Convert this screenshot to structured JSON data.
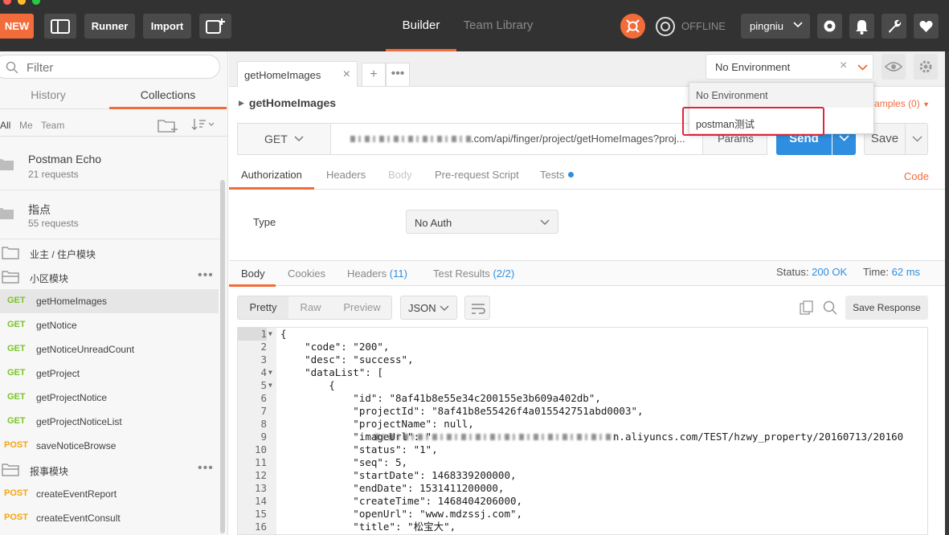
{
  "topbar": {
    "new_label": "NEW",
    "runner_label": "Runner",
    "import_label": "Import",
    "builder_tab": "Builder",
    "team_library_tab": "Team Library",
    "offline_label": "OFFLINE",
    "user": "pingniu",
    "accent": "#f26b3a"
  },
  "sidebar": {
    "filter_placeholder": "Filter",
    "tabs": {
      "history": "History",
      "collections": "Collections"
    },
    "filters": {
      "all": "All",
      "me": "Me",
      "team": "Team"
    },
    "collections": [
      {
        "name": "Postman Echo",
        "count": "21 requests"
      },
      {
        "name": "指点",
        "count": "55 requests"
      }
    ],
    "folders": {
      "f1": "业主 / 住户模块",
      "f2": "小区模块",
      "f3": "报事模块"
    },
    "requests": [
      {
        "method": "GET",
        "name": "getHomeImages"
      },
      {
        "method": "GET",
        "name": "getNotice"
      },
      {
        "method": "GET",
        "name": "getNoticeUnreadCount"
      },
      {
        "method": "GET",
        "name": "getProject"
      },
      {
        "method": "GET",
        "name": "getProjectNotice"
      },
      {
        "method": "GET",
        "name": "getProjectNoticeList"
      },
      {
        "method": "POST",
        "name": "saveNoticeBrowse"
      },
      {
        "method": "POST",
        "name": "createEventReport"
      },
      {
        "method": "POST",
        "name": "createEventConsult"
      }
    ],
    "more": "•••"
  },
  "main": {
    "tab_title": "getHomeImages",
    "tab_close": "×",
    "tab_add": "+",
    "tab_more": "•••",
    "request_title": "getHomeImages",
    "examples": "amples (0)",
    "method": "GET",
    "url": ".com/api/finger/project/getHomeImages?proj...",
    "params": "Params",
    "send": "Send",
    "save": "Save",
    "req_tabs": {
      "authorization": "Authorization",
      "headers": "Headers",
      "body": "Body",
      "prerequest": "Pre-request Script",
      "tests": "Tests"
    },
    "code_link": "Code",
    "auth_type_label": "Type",
    "auth_type_value": "No Auth",
    "resp_tabs": {
      "body": "Body",
      "cookies": "Cookies",
      "headers": "Headers",
      "headers_count": "(11)",
      "test_results": "Test Results",
      "test_results_count": "(2/2)"
    },
    "status_label": "Status:",
    "status_value": "200 OK",
    "time_label": "Time:",
    "time_value": "62 ms",
    "formats": {
      "pretty": "Pretty",
      "raw": "Raw",
      "preview": "Preview"
    },
    "json_label": "JSON",
    "save_response": "Save Response"
  },
  "environment": {
    "selected": "No Environment",
    "clear": "×",
    "options": [
      "No Environment",
      "postman测试"
    ]
  },
  "response_lines": [
    {
      "n": "1",
      "t": "{"
    },
    {
      "n": "2",
      "t": "    \"code\": \"200\","
    },
    {
      "n": "3",
      "t": "    \"desc\": \"success\","
    },
    {
      "n": "4",
      "t": "    \"dataList\": ["
    },
    {
      "n": "5",
      "t": "        {"
    },
    {
      "n": "6",
      "t": "            \"id\": \"8af41b8e55e34c200155e3b609a402db\","
    },
    {
      "n": "7",
      "t": "            \"projectId\": \"8af41b8e55426f4a015542751abd0003\","
    },
    {
      "n": "8",
      "t": "            \"projectName\": null,"
    },
    {
      "n": "9",
      "t": "            \"imageUrl\": \"                              n.aliyuncs.com/TEST/hzwy_property/20160713/20160"
    },
    {
      "n": "10",
      "t": "            \"status\": \"1\","
    },
    {
      "n": "11",
      "t": "            \"seq\": 5,"
    },
    {
      "n": "12",
      "t": "            \"startDate\": 1468339200000,"
    },
    {
      "n": "13",
      "t": "            \"endDate\": 1531411200000,"
    },
    {
      "n": "14",
      "t": "            \"createTime\": 1468404206000,"
    },
    {
      "n": "15",
      "t": "            \"openUrl\": \"www.mdzssj.com\","
    },
    {
      "n": "16",
      "t": "            \"title\": \"松宝大\","
    }
  ]
}
